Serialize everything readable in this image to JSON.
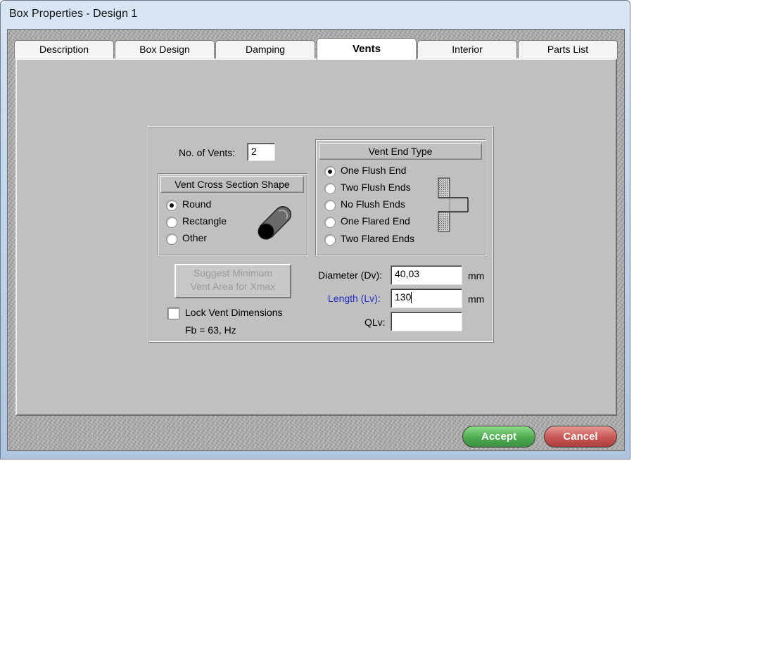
{
  "window": {
    "title": "Box Properties - Design 1"
  },
  "tabs": [
    {
      "label": "Description",
      "active": false
    },
    {
      "label": "Box Design",
      "active": false
    },
    {
      "label": "Damping",
      "active": false
    },
    {
      "label": "Vents",
      "active": true
    },
    {
      "label": "Interior",
      "active": false
    },
    {
      "label": "Parts List",
      "active": false
    }
  ],
  "vents": {
    "no_of_vents_label": "No. of Vents:",
    "no_of_vents_value": "2",
    "cross_section": {
      "title": "Vent Cross Section Shape",
      "options": [
        "Round",
        "Rectangle",
        "Other"
      ],
      "selected": "Round"
    },
    "end_type": {
      "title": "Vent End Type",
      "options": [
        "One Flush End",
        "Two Flush Ends",
        "No Flush Ends",
        "One Flared End",
        "Two Flared Ends"
      ],
      "selected": "One Flush End"
    },
    "suggest_button": {
      "line1": "Suggest Minimum",
      "line2": "Vent Area for Xmax",
      "enabled": false
    },
    "lock_label": "Lock Vent Dimensions",
    "lock_checked": false,
    "fb_text": "Fb = 63, Hz",
    "diameter": {
      "label": "Diameter (Dv):",
      "value": "40,03",
      "unit": "mm"
    },
    "length": {
      "label": "Length (Lv):",
      "value": "130",
      "unit": "mm",
      "label_color": "#1f2fc8"
    },
    "qlv": {
      "label": "QLv:",
      "value": ""
    }
  },
  "buttons": {
    "accept": "Accept",
    "cancel": "Cancel"
  },
  "colors": {
    "accept": "#4dab4f",
    "cancel": "#c85553",
    "panel": "#c0c0c0"
  }
}
